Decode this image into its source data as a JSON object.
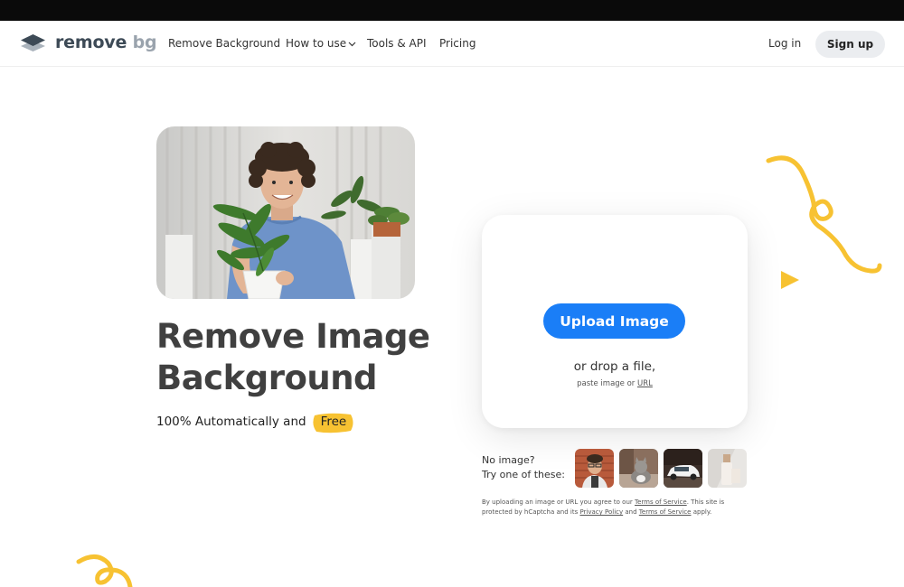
{
  "nav": {
    "logo": {
      "word1": "remove",
      "word2": "bg"
    },
    "links": [
      "Remove Background",
      "How to use",
      "Tools & API",
      "Pricing"
    ],
    "login": "Log in",
    "signup": "Sign up"
  },
  "hero": {
    "title_line1": "Remove Image",
    "title_line2": "Background",
    "subtitle": "100% Automatically and",
    "free_badge": "Free"
  },
  "upload": {
    "button": "Upload Image",
    "drop_text": "or drop a file,",
    "paste_prefix": "paste image or ",
    "paste_url": "URL"
  },
  "samples": {
    "line1": "No image?",
    "line2": "Try one of these:",
    "items": [
      "sample-person",
      "sample-cat",
      "sample-car",
      "sample-bottle"
    ]
  },
  "legal": {
    "p1": "By uploading an image or URL you agree to our ",
    "terms1": "Terms of Service",
    "p2": ". This site is protected by hCaptcha and its ",
    "privacy": "Privacy Policy",
    "p3": " and ",
    "terms2": "Terms of Service",
    "p4": " apply."
  },
  "colors": {
    "accent": "#1a7ef7",
    "highlight": "#f7c232",
    "text_dark": "#404040"
  }
}
